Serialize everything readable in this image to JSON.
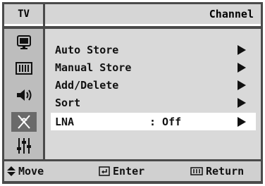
{
  "header": {
    "source_label": "TV",
    "menu_title": "Channel"
  },
  "sidebar": {
    "items": [
      {
        "name": "picture-icon"
      },
      {
        "name": "sound-icon"
      },
      {
        "name": "volume-icon"
      },
      {
        "name": "channel-antenna-icon",
        "active": true
      },
      {
        "name": "setup-sliders-icon"
      }
    ]
  },
  "menu": {
    "items": [
      {
        "label": "Auto Store"
      },
      {
        "label": "Manual Store"
      },
      {
        "label": "Add/Delete"
      },
      {
        "label": "Sort"
      },
      {
        "label": "LNA",
        "value": ": Off",
        "selected": true
      }
    ]
  },
  "footer": {
    "move_label": "Move",
    "enter_label": "Enter",
    "return_label": "Return"
  },
  "colors": {
    "frame": "#4a4a4a",
    "panel": "#d9d9d9",
    "highlight": "#ffffff",
    "sidebar": "#bdbdbd"
  }
}
